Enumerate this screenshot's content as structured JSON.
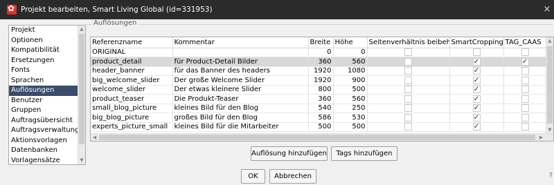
{
  "window": {
    "title": "Projekt bearbeiten, Smart Living Global (id=331953)",
    "close_glyph": "×"
  },
  "nav": {
    "selected": "Auflösungen",
    "items": [
      "Projekt",
      "Optionen",
      "Kompatibilität",
      "Ersetzungen",
      "Fonts",
      "Sprachen",
      "Auflösungen",
      "Benutzer",
      "Gruppen",
      "Auftragsübersicht",
      "Auftragsverwaltung",
      "Aktionsvorlagen",
      "Datenbanken",
      "Vorlagensätze"
    ]
  },
  "group": {
    "legend": "Auflösungen"
  },
  "table": {
    "headers": [
      "Referenzname",
      "Kommentar",
      "Breite",
      "Höhe",
      "Seitenverhältnis beibehal...",
      "SmartCropping",
      "TAG_CAAS"
    ],
    "selected_row": 1,
    "rows": [
      {
        "name": "ORIGINAL",
        "comment": "",
        "width": "0",
        "height": "0",
        "keep_ratio": false,
        "smart_cropping": false,
        "tag_caas": false
      },
      {
        "name": "product_detail",
        "comment": "für Product-Detail Bilder",
        "width": "360",
        "height": "560",
        "keep_ratio": false,
        "smart_cropping": true,
        "tag_caas": true
      },
      {
        "name": "header_banner",
        "comment": "für das Banner des headers",
        "width": "1920",
        "height": "1080",
        "keep_ratio": false,
        "smart_cropping": true,
        "tag_caas": false
      },
      {
        "name": "big_welcome_slider",
        "comment": "Der große Welcome Slider",
        "width": "1920",
        "height": "900",
        "keep_ratio": false,
        "smart_cropping": true,
        "tag_caas": false
      },
      {
        "name": "welcome_slider",
        "comment": "Der etwas kleinere Slider",
        "width": "800",
        "height": "500",
        "keep_ratio": false,
        "smart_cropping": true,
        "tag_caas": false
      },
      {
        "name": "product_teaser",
        "comment": "Die Produkt-Teaser",
        "width": "360",
        "height": "560",
        "keep_ratio": false,
        "smart_cropping": true,
        "tag_caas": false
      },
      {
        "name": "small_blog_picture",
        "comment": "kleines Bild für den Blog",
        "width": "540",
        "height": "250",
        "keep_ratio": false,
        "smart_cropping": true,
        "tag_caas": false
      },
      {
        "name": "big_blog_picture",
        "comment": "großes Bild für den Blog",
        "width": "586",
        "height": "530",
        "keep_ratio": false,
        "smart_cropping": true,
        "tag_caas": false
      },
      {
        "name": "experts_picture_small",
        "comment": "kleines Bild für die Mitarbeiter",
        "width": "500",
        "height": "500",
        "keep_ratio": false,
        "smart_cropping": true,
        "tag_caas": false
      }
    ]
  },
  "buttons": {
    "add_resolution": "Auflösung hinzufügen",
    "add_tags": "Tags hinzufügen",
    "ok": "OK",
    "cancel": "Abbrechen"
  },
  "help": {
    "glyph": "?"
  },
  "icons": {
    "app": "project-icon",
    "check": "✓",
    "up": "▲",
    "down": "▼",
    "left": "◀",
    "right": "▶"
  },
  "colors": {
    "titlebar": "#2b2b2b",
    "nav_selected": "#3a4c69",
    "row_selected": "#d8d8d8",
    "app_icon": "#d9342b"
  }
}
